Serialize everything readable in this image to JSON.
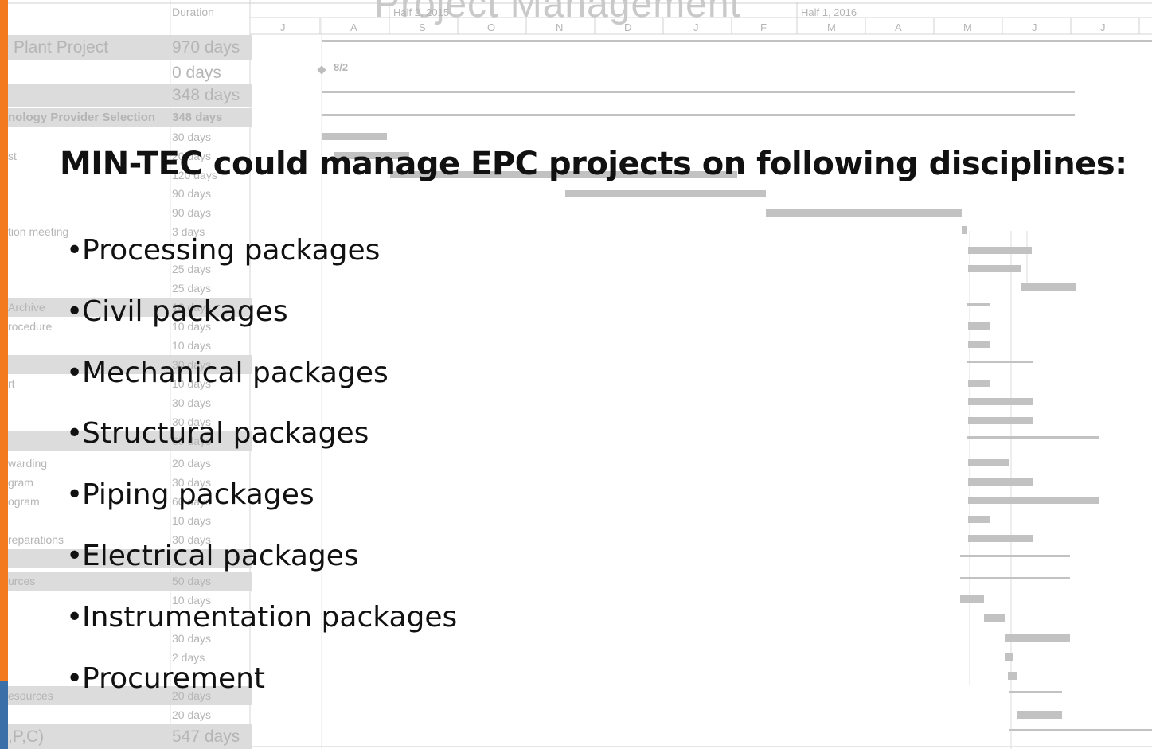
{
  "background_title": "Project Management",
  "gantt": {
    "duration_header": "Duration",
    "half_labels": [
      "Half 2, 2015",
      "Half 1, 2016"
    ],
    "months": [
      "J",
      "A",
      "S",
      "O",
      "N",
      "D",
      "J",
      "F",
      "M",
      "A",
      "M",
      "J",
      "J"
    ],
    "milestone_label": "8/2",
    "rows": [
      {
        "name": "Plant Project",
        "duration": "970 days",
        "summary": true
      },
      {
        "name": "",
        "duration": "0 days",
        "summary": false
      },
      {
        "name": "",
        "duration": "348 days",
        "summary": true
      },
      {
        "name": "nology Provider Selection",
        "duration": "348 days",
        "summary": true
      },
      {
        "name": "",
        "duration": "30 days",
        "summary": false
      },
      {
        "name": "st",
        "duration": "20 days",
        "summary": false
      },
      {
        "name": "",
        "duration": "120 days",
        "summary": false
      },
      {
        "name": "",
        "duration": "90 days",
        "summary": false
      },
      {
        "name": "",
        "duration": "90 days",
        "summary": false
      },
      {
        "name": "tion meeting",
        "duration": "3 days",
        "summary": false
      },
      {
        "name": "",
        "duration": "",
        "summary": false
      },
      {
        "name": "",
        "duration": "25 days",
        "summary": false
      },
      {
        "name": "",
        "duration": "25 days",
        "summary": false
      },
      {
        "name": "Archive",
        "duration": "10 days",
        "summary": true
      },
      {
        "name": "rocedure",
        "duration": "10 days",
        "summary": false
      },
      {
        "name": "",
        "duration": "10 days",
        "summary": false
      },
      {
        "name": "",
        "duration": "30 days",
        "summary": true
      },
      {
        "name": "rt",
        "duration": "10 days",
        "summary": false
      },
      {
        "name": "",
        "duration": "30 days",
        "summary": false
      },
      {
        "name": "",
        "duration": "30 days",
        "summary": false
      },
      {
        "name": "",
        "duration": "60 days",
        "summary": true
      },
      {
        "name": "warding",
        "duration": "20 days",
        "summary": false
      },
      {
        "name": "gram",
        "duration": "30 days",
        "summary": false
      },
      {
        "name": "ogram",
        "duration": "60 days",
        "summary": false
      },
      {
        "name": "",
        "duration": "10 days",
        "summary": false
      },
      {
        "name": "reparations",
        "duration": "30 days",
        "summary": false
      },
      {
        "name": "",
        "duration": "",
        "summary": true
      },
      {
        "name": "urces",
        "duration": "50 days",
        "summary": true
      },
      {
        "name": "",
        "duration": "10 days",
        "summary": false
      },
      {
        "name": "",
        "duration": "",
        "summary": false
      },
      {
        "name": "",
        "duration": "30 days",
        "summary": false
      },
      {
        "name": "",
        "duration": "2 days",
        "summary": false
      },
      {
        "name": "",
        "duration": "",
        "summary": false
      },
      {
        "name": "esources",
        "duration": "20 days",
        "summary": true
      },
      {
        "name": "",
        "duration": "20 days",
        "summary": false
      },
      {
        "name": ",P,C)",
        "duration": "547 days",
        "summary": true
      }
    ]
  },
  "content": {
    "headline": "MIN-TEC could manage EPC projects on following disciplines:",
    "bullet_glyph": "•",
    "bullets": [
      "Processing packages",
      "Civil packages",
      "Mechanical packages",
      "Structural packages",
      "Piping packages",
      "Electrical packages",
      "Instrumentation packages",
      "Procurement"
    ]
  },
  "colors": {
    "accent_orange": "#f47a20",
    "accent_blue": "#3a6fa8",
    "gantt_bar": "#c2c2c2",
    "gantt_text": "#b5b5b5"
  }
}
